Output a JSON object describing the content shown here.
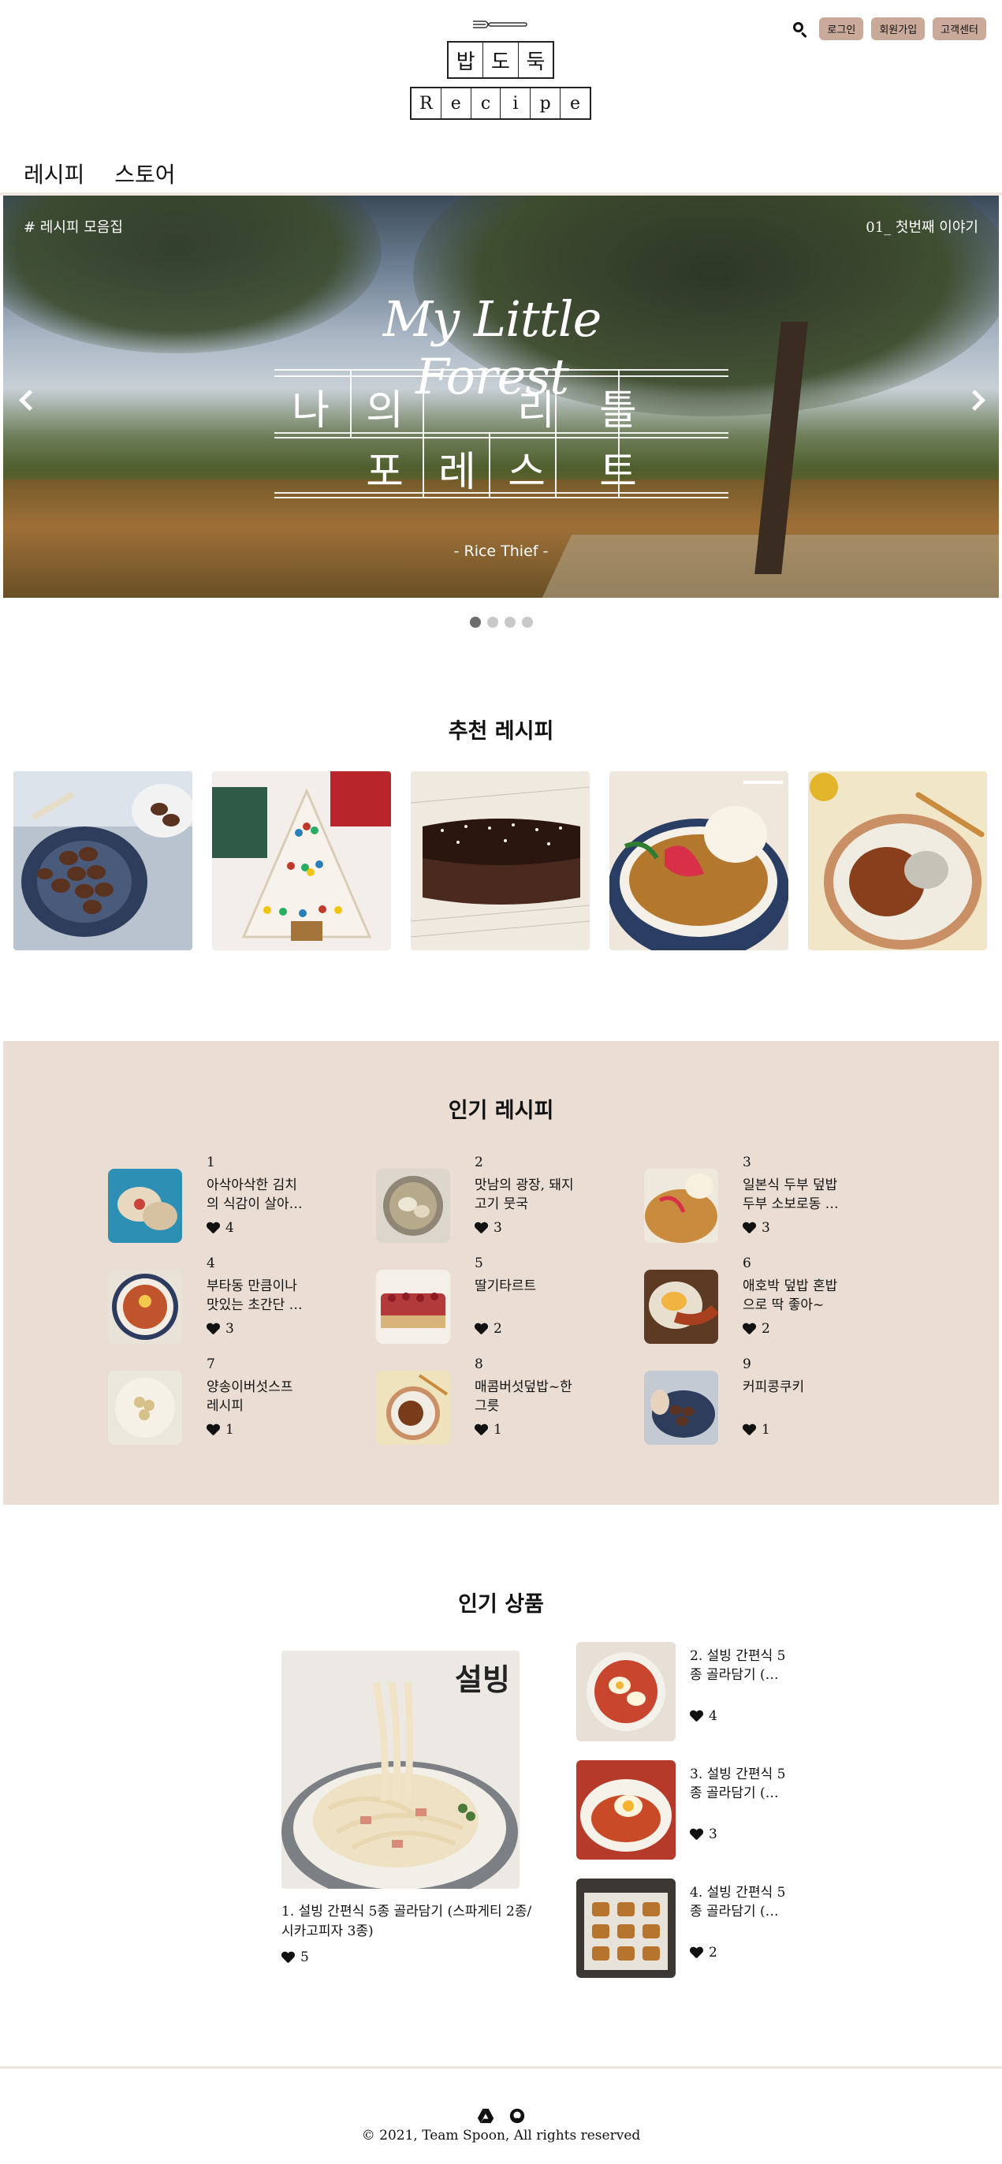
{
  "header": {
    "logo_top": [
      "밥",
      "도",
      "둑"
    ],
    "logo_bottom": [
      "R",
      "e",
      "c",
      "i",
      "p",
      "e"
    ],
    "login_label": "로그인",
    "signup_label": "회원가입",
    "support_label": "고객센터",
    "search_icon": "search-icon"
  },
  "nav": {
    "items": [
      {
        "label": "레시피"
      },
      {
        "label": "스토어"
      }
    ]
  },
  "hero": {
    "tag": "# 레시피 모음집",
    "counter": "01_ 첫번째 이야기",
    "script_title": "My Little Forest",
    "row1": [
      "나",
      "의",
      "리",
      "틀"
    ],
    "row2": [
      "포",
      "레",
      "스",
      "트"
    ],
    "subtitle": "- Rice Thief -",
    "active_slide": 1,
    "slide_count": 4
  },
  "recommended": {
    "title": "추천 레시피",
    "items": [
      {
        "name": "coffee-bean-cookies"
      },
      {
        "name": "christmas-tree-cookies"
      },
      {
        "name": "chocolate-pound-cake"
      },
      {
        "name": "natto-rice-bowl"
      },
      {
        "name": "kimchi-rice-plate"
      }
    ]
  },
  "popular": {
    "title": "인기 레시피",
    "items": [
      {
        "rank": "1",
        "title": "아삭아삭한 김치의 식감이 살아…",
        "likes": "4"
      },
      {
        "rank": "2",
        "title": "맛남의 광장, 돼지고기 뭇국",
        "likes": "3"
      },
      {
        "rank": "3",
        "title": "일본식 두부 덮밥 두부 소보로동 …",
        "likes": "3"
      },
      {
        "rank": "4",
        "title": "부타동 만큼이나 맛있는 초간단 …",
        "likes": "3"
      },
      {
        "rank": "5",
        "title": "딸기타르트",
        "likes": "2"
      },
      {
        "rank": "6",
        "title": "애호박 덮밥 혼밥으로 딱 좋아~",
        "likes": "2"
      },
      {
        "rank": "7",
        "title": "양송이버섯스프 레시피",
        "likes": "1"
      },
      {
        "rank": "8",
        "title": "매콤버섯덮밥~한그릇",
        "likes": "1"
      },
      {
        "rank": "9",
        "title": "커피콩쿠키",
        "likes": "1"
      }
    ]
  },
  "products": {
    "title": "인기 상품",
    "main": {
      "title": "1. 설빙 간편식 5종 골라담기 (스파게티 2종/시카고피자 3종)",
      "likes": "5",
      "brand": "설빙"
    },
    "side": [
      {
        "title": "2. 설빙 간편식 5종 골라담기 (…",
        "likes": "4"
      },
      {
        "title": "3. 설빙 간편식 5종 골라담기 (…",
        "likes": "3"
      },
      {
        "title": "4. 설빙 간편식 5종 골라담기 (…",
        "likes": "2"
      }
    ]
  },
  "footer": {
    "copyright": "© 2021, Team Spoon, All rights reserved",
    "icons": [
      "google-drive-icon",
      "github-icon"
    ]
  }
}
